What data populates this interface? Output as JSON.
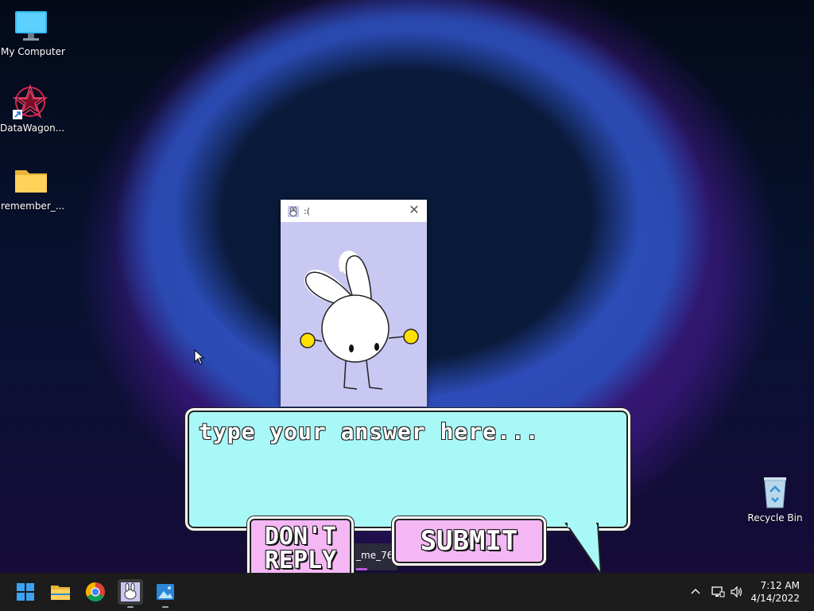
{
  "desktop": {
    "icons": [
      {
        "label": "My Computer",
        "icon": "monitor-icon"
      },
      {
        "label": "DataWagon...",
        "icon": "datawagon-icon"
      },
      {
        "label": "remember_...",
        "icon": "folder-icon"
      },
      {
        "label": "Recycle Bin",
        "icon": "recycle-bin-icon"
      }
    ]
  },
  "popup": {
    "title": ":(",
    "close_glyph": "✕",
    "title_icon": "bunny-app-icon",
    "content_icon": "bunny-character"
  },
  "dialog": {
    "input_placeholder": "type your answer here...",
    "input_value": "",
    "dont_reply_line1": "DON'T",
    "dont_reply_line2": "REPLY",
    "submit_label": "SUBMIT"
  },
  "partial_window": {
    "title": "_me_76"
  },
  "taskbar": {
    "apps": [
      {
        "name": "start-button",
        "icon": "windows-start-icon"
      },
      {
        "name": "file-explorer",
        "icon": "folder-icon"
      },
      {
        "name": "chrome",
        "icon": "chrome-icon"
      },
      {
        "name": "bunny-app",
        "icon": "bunny-app-icon"
      },
      {
        "name": "photos",
        "icon": "photos-icon"
      }
    ],
    "tray": {
      "chevron": "^",
      "network_icon": "network-icon",
      "volume_icon": "volume-icon"
    },
    "clock": {
      "time": "7:12 AM",
      "date": "4/14/2022"
    }
  },
  "colors": {
    "bubble": "#a9f8f8",
    "button": "#f4b7f4",
    "popup_bg": "#c9c8f2",
    "taskbar": "#1c1c1c"
  }
}
